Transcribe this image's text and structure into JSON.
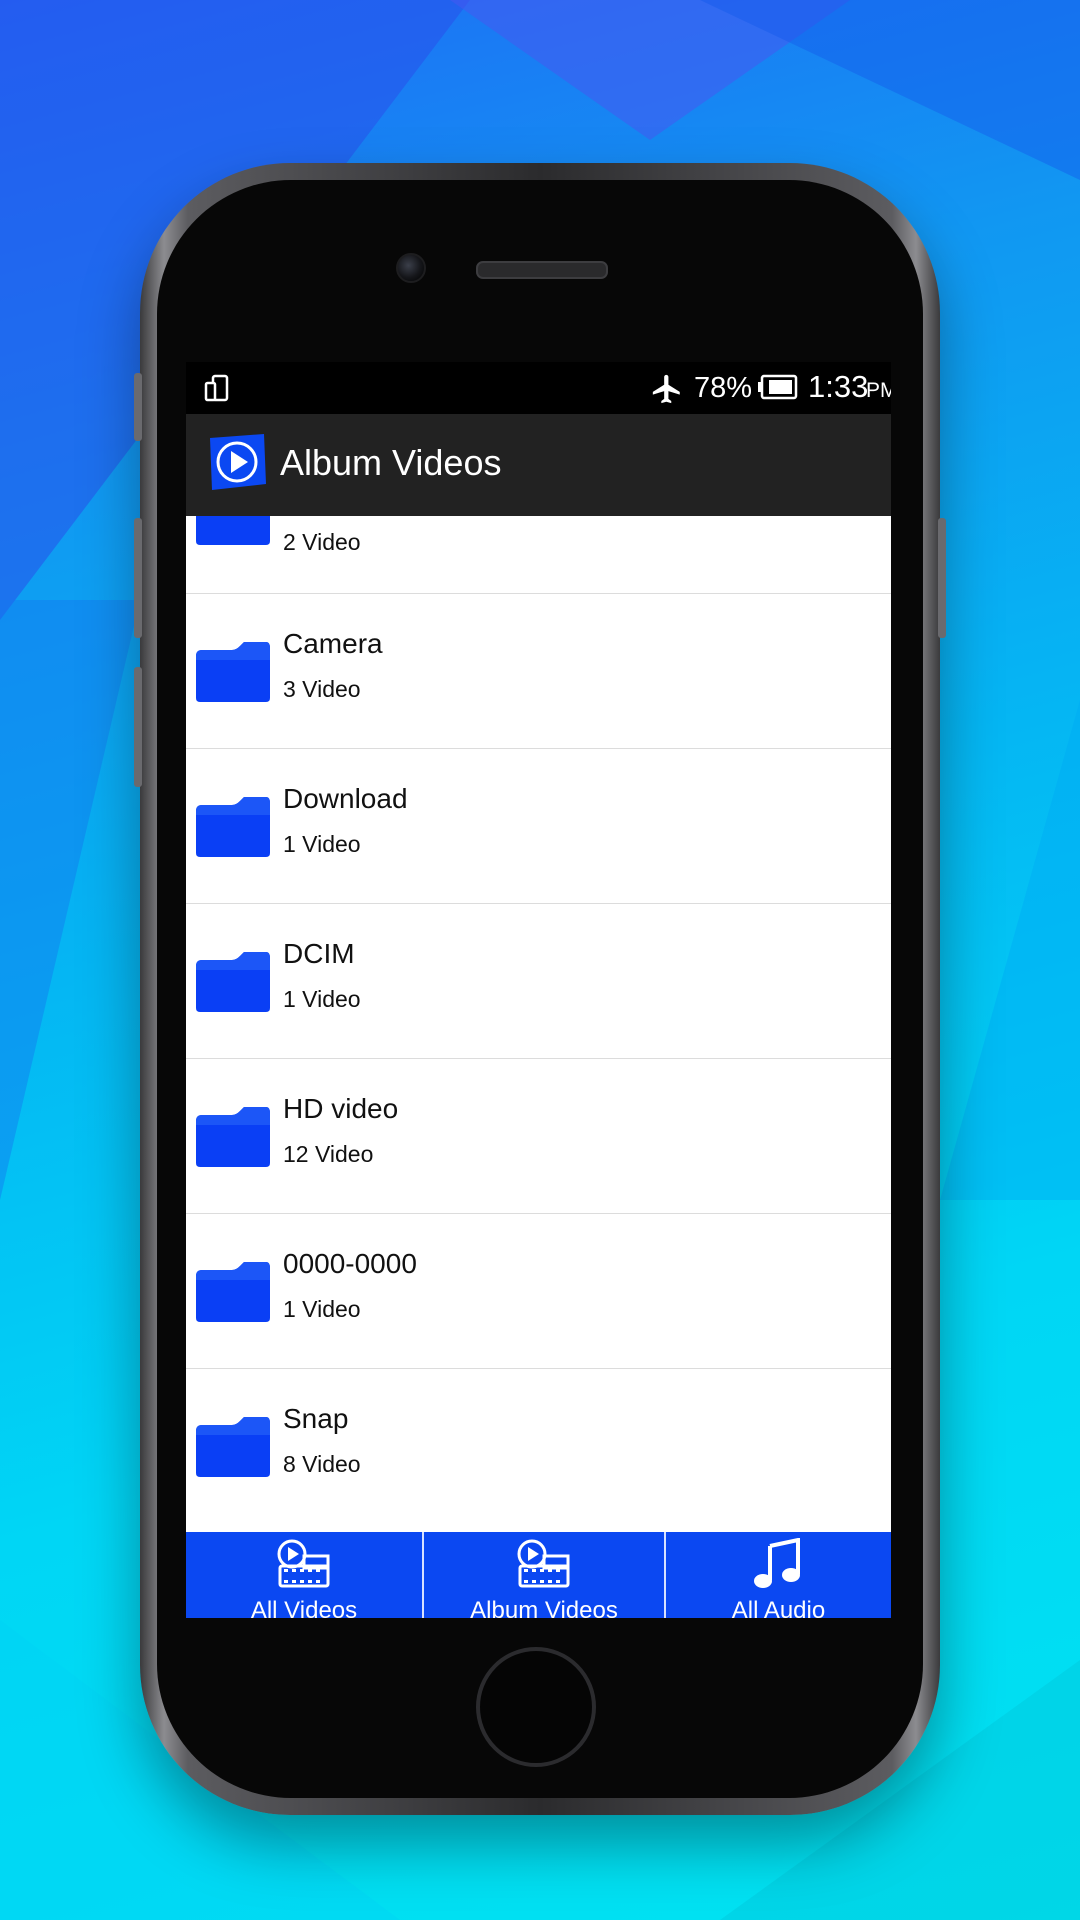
{
  "status_bar": {
    "battery_percent": "78%",
    "time": "1:33",
    "ampm": "PM"
  },
  "app_bar": {
    "title": "Album Videos"
  },
  "albums": [
    {
      "name": "",
      "count": "2 Video"
    },
    {
      "name": "Camera",
      "count": "3 Video"
    },
    {
      "name": "Download",
      "count": "1 Video"
    },
    {
      "name": "DCIM",
      "count": "1 Video"
    },
    {
      "name": "HD video",
      "count": "12 Video"
    },
    {
      "name": "0000-0000",
      "count": "1 Video"
    },
    {
      "name": "Snap",
      "count": "8 Video"
    }
  ],
  "bottom_nav": {
    "items": [
      {
        "label": "All Videos",
        "icon": "video-folder-icon"
      },
      {
        "label": "Album Videos",
        "icon": "video-folder-icon"
      },
      {
        "label": "All Audio",
        "icon": "music-note-icon"
      }
    ]
  },
  "colors": {
    "accent": "#0b48f2",
    "folder": "#0a3ff5",
    "app_bar": "#222222",
    "status_bar": "#000000"
  }
}
